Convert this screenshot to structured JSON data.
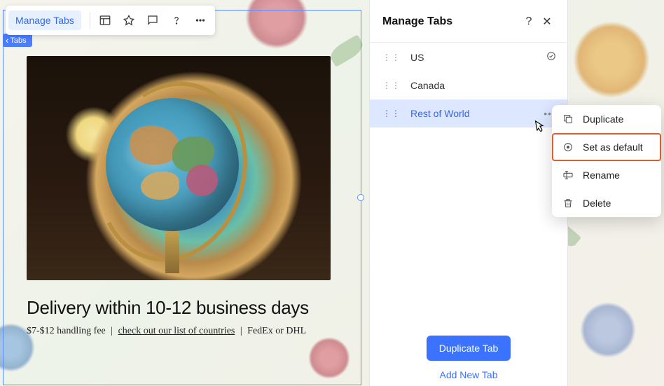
{
  "toolbar": {
    "chip_label": "Manage Tabs"
  },
  "selection": {
    "badge_label": "Tabs"
  },
  "content": {
    "headline": "Delivery within 10-12 business days",
    "sub_fee": "$7-$12 handling fee",
    "sub_link": "check out our list of countries",
    "sub_carrier": "FedEx or DHL"
  },
  "panel": {
    "title": "Manage Tabs",
    "tabs": [
      {
        "label": "US",
        "default": true
      },
      {
        "label": "Canada",
        "default": false
      },
      {
        "label": "Rest of World",
        "default": false
      }
    ],
    "duplicate_btn": "Duplicate Tab",
    "add_btn": "Add New Tab"
  },
  "context_menu": {
    "items": [
      {
        "label": "Duplicate"
      },
      {
        "label": "Set as default"
      },
      {
        "label": "Rename"
      },
      {
        "label": "Delete"
      }
    ]
  }
}
